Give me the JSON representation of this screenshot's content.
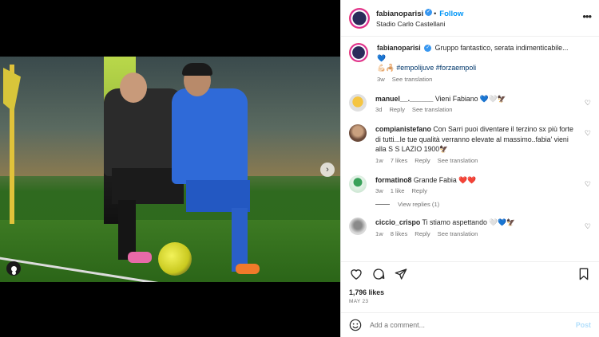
{
  "header": {
    "username": "fabianoparisi",
    "follow_label": "Follow",
    "location": "Stadio Carlo Castellani",
    "more_label": "•••"
  },
  "caption": {
    "username": "fabianoparisi",
    "text": "Gruppo fantastico, serata indimenticabile...💙",
    "text2": "💪🏻🦂",
    "hashtags": "#empolijuve #forzaempoli",
    "time": "3w",
    "translate": "See translation"
  },
  "comments": [
    {
      "username": "manuel__.______",
      "text": "Vieni Fabiano 💙🤍🦅",
      "time": "3d",
      "likes": "",
      "reply": "Reply",
      "translate": "See translation"
    },
    {
      "username": "compianistefano",
      "text": "Con Sarri puoi diventare il terzino sx più forte di tutti...le tue qualità verranno elevate al massimo..fabia' vieni alla S S LAZIO 1900🦅",
      "time": "1w",
      "likes": "7 likes",
      "reply": "Reply",
      "translate": "See translation"
    },
    {
      "username": "formatino8",
      "text": "Grande Fabia ❤️❤️",
      "time": "3w",
      "likes": "1 like",
      "reply": "Reply",
      "translate": ""
    },
    {
      "username": "ciccio_crispo",
      "text": "Ti stiamo aspettando 🤍💙🦅",
      "time": "1w",
      "likes": "8 likes",
      "reply": "Reply",
      "translate": "See translation"
    }
  ],
  "view_replies": "View replies (1)",
  "post": {
    "likes": "1,796 likes",
    "date": "MAY 23"
  },
  "add_comment": {
    "placeholder": "Add a comment...",
    "post_label": "Post"
  },
  "icons": {
    "heart": "heart-icon",
    "comment": "comment-icon",
    "share": "share-icon",
    "save": "bookmark-icon",
    "emoji": "emoji-icon"
  },
  "colors": {
    "accent": "#0095f6",
    "verified": "#3897f0",
    "muted": "#737373",
    "hashtag": "#00376b"
  },
  "carousel": {
    "count": 5,
    "active": 1
  }
}
